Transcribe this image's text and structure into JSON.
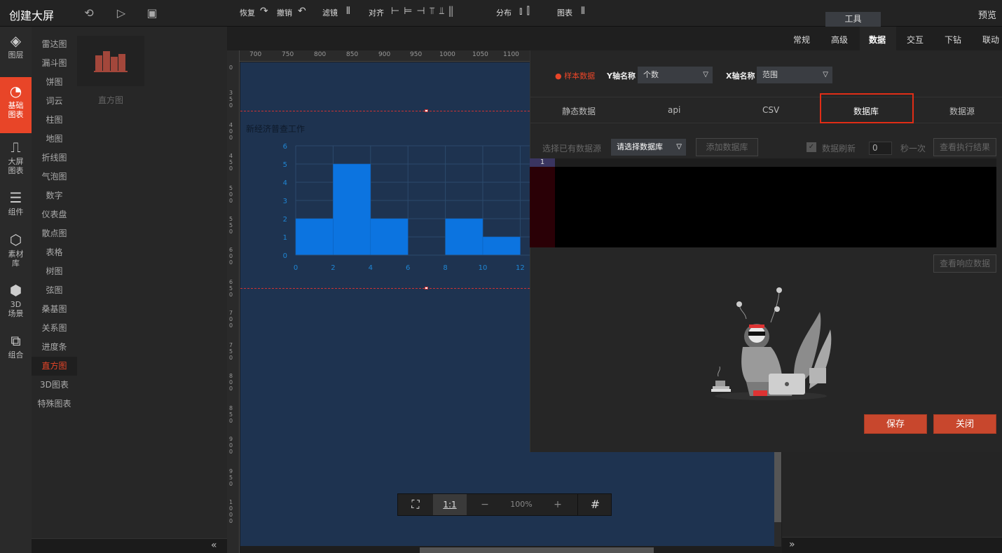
{
  "app": {
    "title": "创建大屏",
    "preview": "预览",
    "tools_tab": "工具"
  },
  "leftnav": [
    {
      "label": "图层",
      "icon": "layers-icon",
      "glyph": "◈"
    },
    {
      "label": "基础图表",
      "icon": "pie-chart-icon",
      "glyph": "◔"
    },
    {
      "label": "大屏图表",
      "icon": "monitor-chart-icon",
      "glyph": "⎍"
    },
    {
      "label": "组件",
      "icon": "sliders-icon",
      "glyph": "☰"
    },
    {
      "label": "素材库",
      "icon": "hexagons-icon",
      "glyph": "⬡"
    },
    {
      "label": "3D场景",
      "icon": "cube-icon",
      "glyph": "⬢"
    },
    {
      "label": "组合",
      "icon": "group-icon",
      "glyph": "⧉"
    }
  ],
  "categories": [
    "雷达图",
    "漏斗图",
    "饼图",
    "词云",
    "柱图",
    "地图",
    "折线图",
    "气泡图",
    "数字",
    "仪表盘",
    "散点图",
    "表格",
    "树图",
    "弦图",
    "桑基图",
    "关系图",
    "进度条",
    "直方图",
    "3D图表",
    "特殊图表"
  ],
  "active_category": "直方图",
  "thumbnail": {
    "label": "直方图"
  },
  "toolbar": {
    "redo": "恢复",
    "undo": "撤销",
    "filter": "滤镜",
    "align": "对齐",
    "distribute": "分布",
    "chart": "图表"
  },
  "ruler_h": [
    "700",
    "750",
    "800",
    "850",
    "900",
    "950",
    "1000",
    "1050",
    "1100"
  ],
  "ruler_v": [
    "0",
    "350",
    "400",
    "450",
    "500",
    "550",
    "600",
    "650",
    "700",
    "750",
    "800",
    "850",
    "900",
    "950",
    "1000"
  ],
  "chart": {
    "title": "新经济普查工作"
  },
  "chart_data": {
    "type": "bar",
    "bins": [
      [
        0,
        2
      ],
      [
        2,
        4
      ],
      [
        4,
        6
      ],
      [
        6,
        8
      ],
      [
        8,
        10
      ],
      [
        10,
        12
      ]
    ],
    "values": [
      2,
      5,
      2,
      0,
      2,
      1
    ],
    "xticks": [
      "0",
      "2",
      "4",
      "6",
      "8",
      "10",
      "12"
    ],
    "yticks": [
      "0",
      "1",
      "2",
      "3",
      "4",
      "5",
      "6"
    ],
    "ylim": [
      0,
      6
    ],
    "bar_color": "#0c74e0"
  },
  "zoom": {
    "ratio": "1:1",
    "minus": "−",
    "level": "100%",
    "plus": "+"
  },
  "tabs": [
    "常规",
    "高级",
    "数据",
    "交互",
    "下钻",
    "联动"
  ],
  "active_tab": "数据",
  "data_panel": {
    "sample_label": "样本数据",
    "y_axis_label": "Y轴名称",
    "y_axis_value": "个数",
    "x_axis_label": "X轴名称",
    "x_axis_value": "范围",
    "subtabs": [
      "静态数据",
      "api",
      "CSV",
      "数据库",
      "数据源"
    ],
    "active_subtab": "数据库",
    "select_source_label": "选择已有数据源",
    "select_db_placeholder": "请选择数据库",
    "add_db": "添加数据库",
    "refresh_label": "数据刷新",
    "refresh_value": "0",
    "refresh_unit": "秒一次",
    "view_result": "查看执行结果",
    "editor_line": "1",
    "view_response": "查看响应数据",
    "save": "保存",
    "close": "关闭"
  }
}
